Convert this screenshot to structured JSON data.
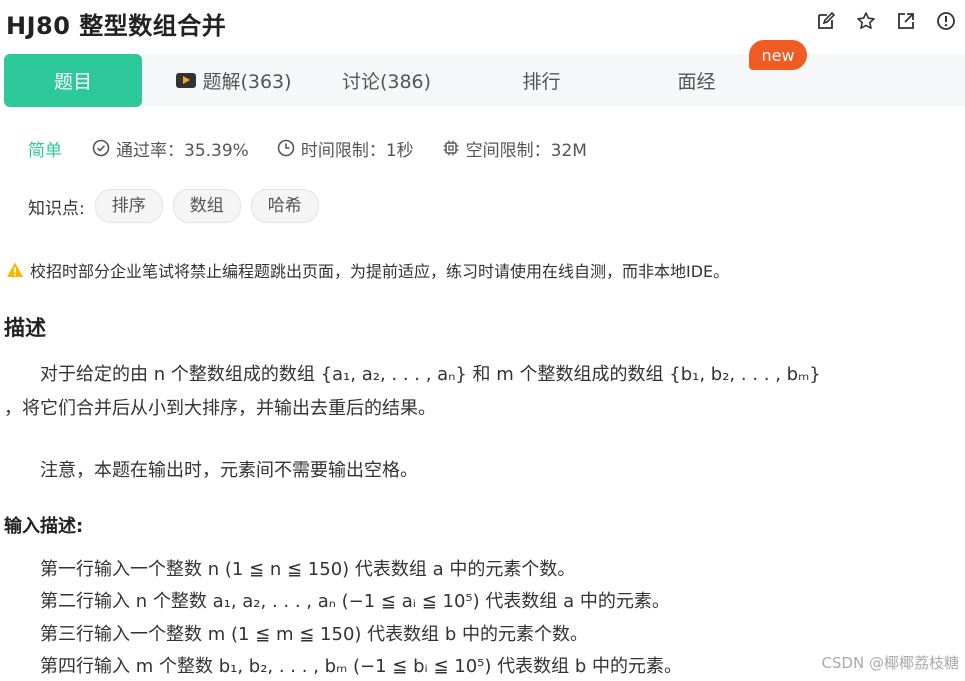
{
  "header": {
    "title": "HJ80  整型数组合并",
    "icons": [
      "edit-icon",
      "star-icon",
      "share-icon",
      "report-icon"
    ]
  },
  "tabs": [
    {
      "label": "题目",
      "active": true
    },
    {
      "label": "题解(363)"
    },
    {
      "label": "讨论(386)"
    },
    {
      "label": "排行"
    },
    {
      "label": "面经"
    }
  ],
  "new_badge": "new",
  "meta": {
    "difficulty": "简单",
    "pass_rate": "通过率：35.39%",
    "time_limit": "时间限制：1秒",
    "memory_limit": "空间限制：32M"
  },
  "knowledge": {
    "label": "知识点:",
    "tags": [
      "排序",
      "数组",
      "哈希"
    ]
  },
  "warning": "校招时部分企业笔试将禁止编程题跳出页面，为提前适应，练习时请使用在线自测，而非本地IDE。",
  "description": {
    "heading": "描述",
    "line1": "对于给定的由 n 个整数组成的数组 {a₁, a₂, . . . , aₙ} 和 m 个整数组成的数组 {b₁, b₂, . . . , bₘ}",
    "line2": "，将它们合并后从小到大排序，并输出去重后的结果。",
    "note": "注意，本题在输出时，元素间不需要输出空格。"
  },
  "input": {
    "heading": "输入描述:",
    "lines": [
      "第一行输入一个整数 n (1 ≦ n ≦ 150) 代表数组 a 中的元素个数。",
      "第二行输入 n 个整数 a₁, a₂, . . . , aₙ (−1 ≦ aᵢ ≦ 10⁵) 代表数组 a 中的元素。",
      "第三行输入一个整数 m (1 ≦ m ≦ 150) 代表数组 b 中的元素个数。",
      "第四行输入 m 个整数 b₁, b₂, . . . , bₘ (−1 ≦ bᵢ ≦ 10⁵) 代表数组 b 中的元素。"
    ]
  },
  "watermark": "CSDN @椰椰荔枝糖",
  "colors": {
    "accent": "#2ec99a",
    "badge": "#f05a23",
    "warning": "#f5b800"
  }
}
